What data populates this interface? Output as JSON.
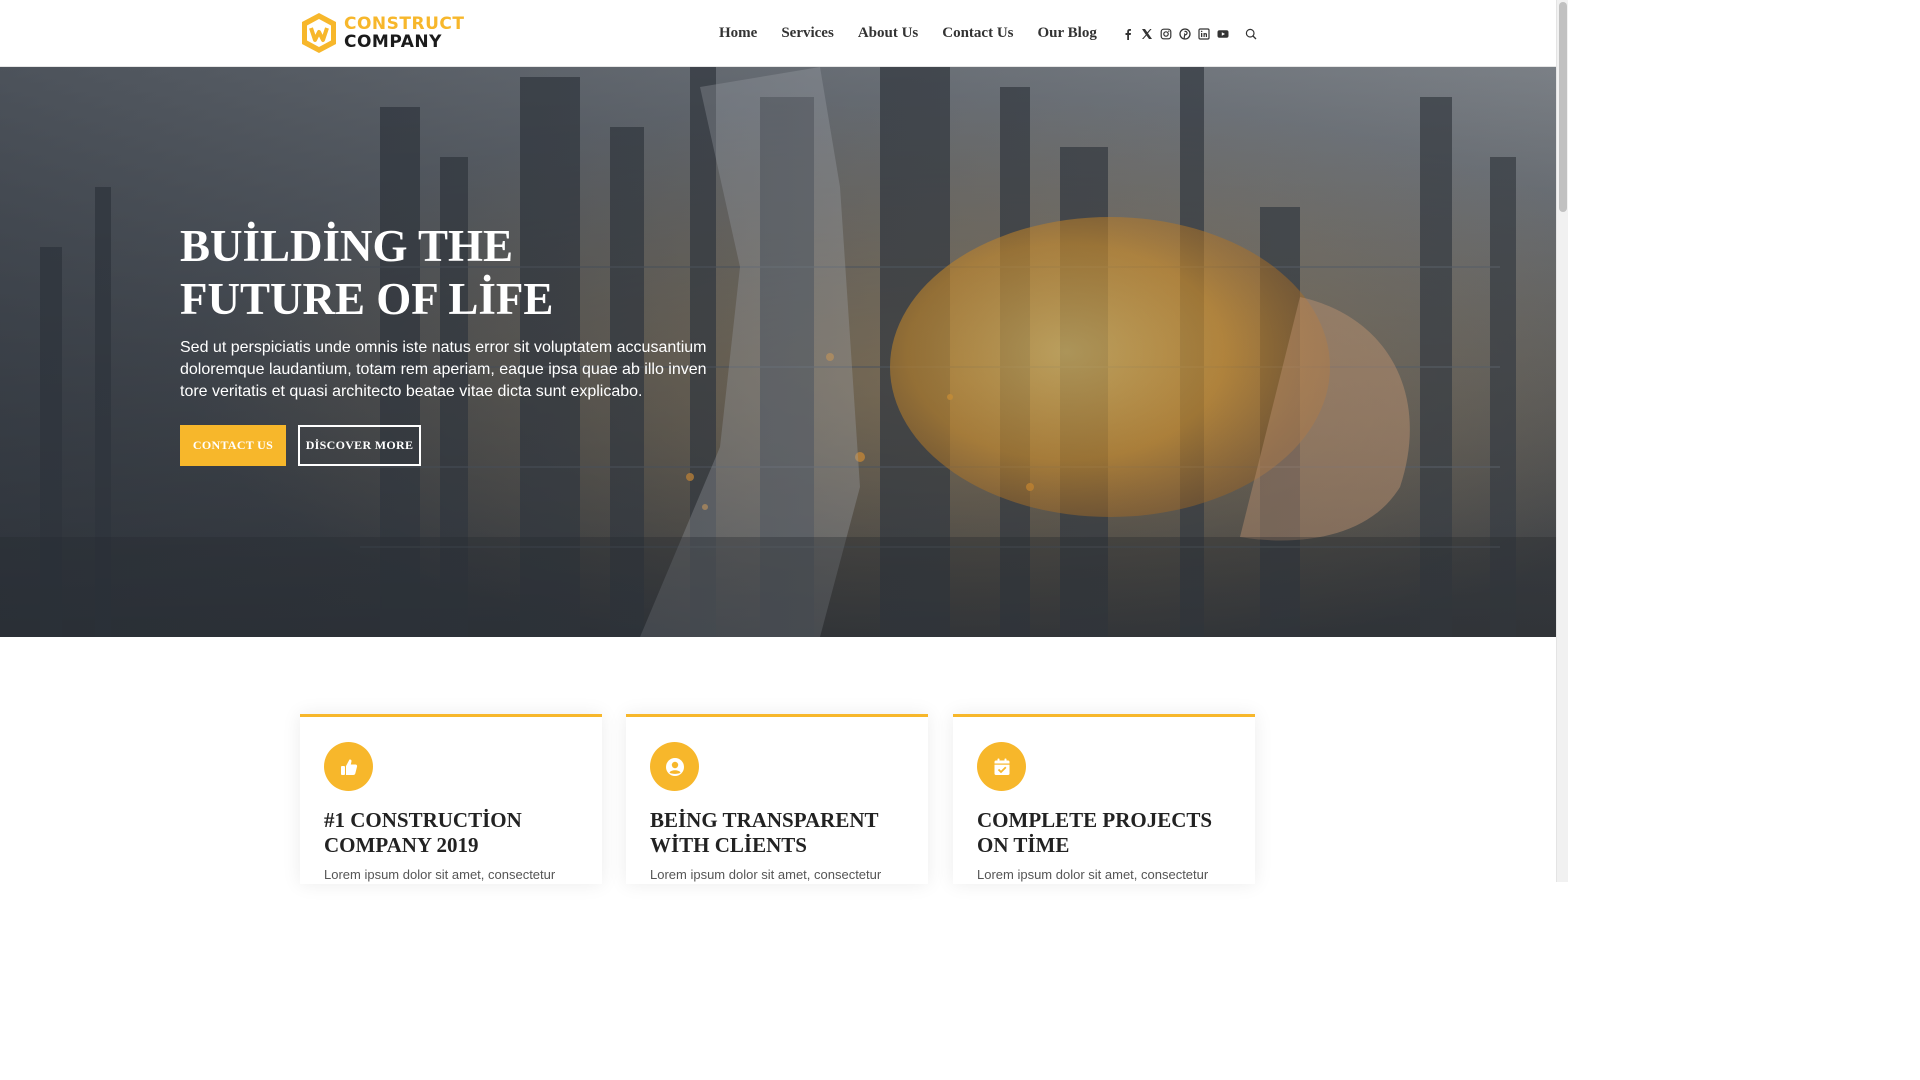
{
  "header": {
    "logo": {
      "line1": "CONSTRUCT",
      "line2": "COMPANY",
      "icon": "construct-logo-mark"
    },
    "nav": [
      {
        "label": "Home"
      },
      {
        "label": "Services"
      },
      {
        "label": "About Us"
      },
      {
        "label": "Contact Us"
      },
      {
        "label": "Our Blog"
      }
    ],
    "socials": [
      "facebook-icon",
      "x-twitter-icon",
      "instagram-icon",
      "pinterest-icon",
      "linkedin-icon",
      "youtube-icon"
    ],
    "search_icon": "search-icon"
  },
  "hero": {
    "title_line1": "BUİLDİNG THE",
    "title_line2": "FUTURE OF LİFE",
    "text": "Sed ut perspiciatis unde omnis iste natus error sit voluptatem accusantium doloremque laudantium, totam rem aperiam, eaque ipsa quae ab illo inven tore veritatis et quasi architecto beatae vitae dicta sunt explicabo.",
    "contact_button": "CONTACT US",
    "discover_button": "DİSCOVER MORE"
  },
  "features": [
    {
      "icon": "thumbs-up-icon",
      "title_line1": "#1 CONSTRUCTİON",
      "title_line2": "COMPANY 2019",
      "text": "Lorem ipsum dolor sit amet, consectetur"
    },
    {
      "icon": "user-circle-icon",
      "title_line1": "BEİNG TRANSPARENT",
      "title_line2": "WİTH CLİENTS",
      "text": "Lorem ipsum dolor sit amet, consectetur"
    },
    {
      "icon": "calendar-check-icon",
      "title_line1": "COMPLETE PROJECTS",
      "title_line2": "ON TİME",
      "text": "Lorem ipsum dolor sit amet, consectetur"
    }
  ],
  "colors": {
    "accent": "#f7b72b",
    "dark": "#222222"
  }
}
